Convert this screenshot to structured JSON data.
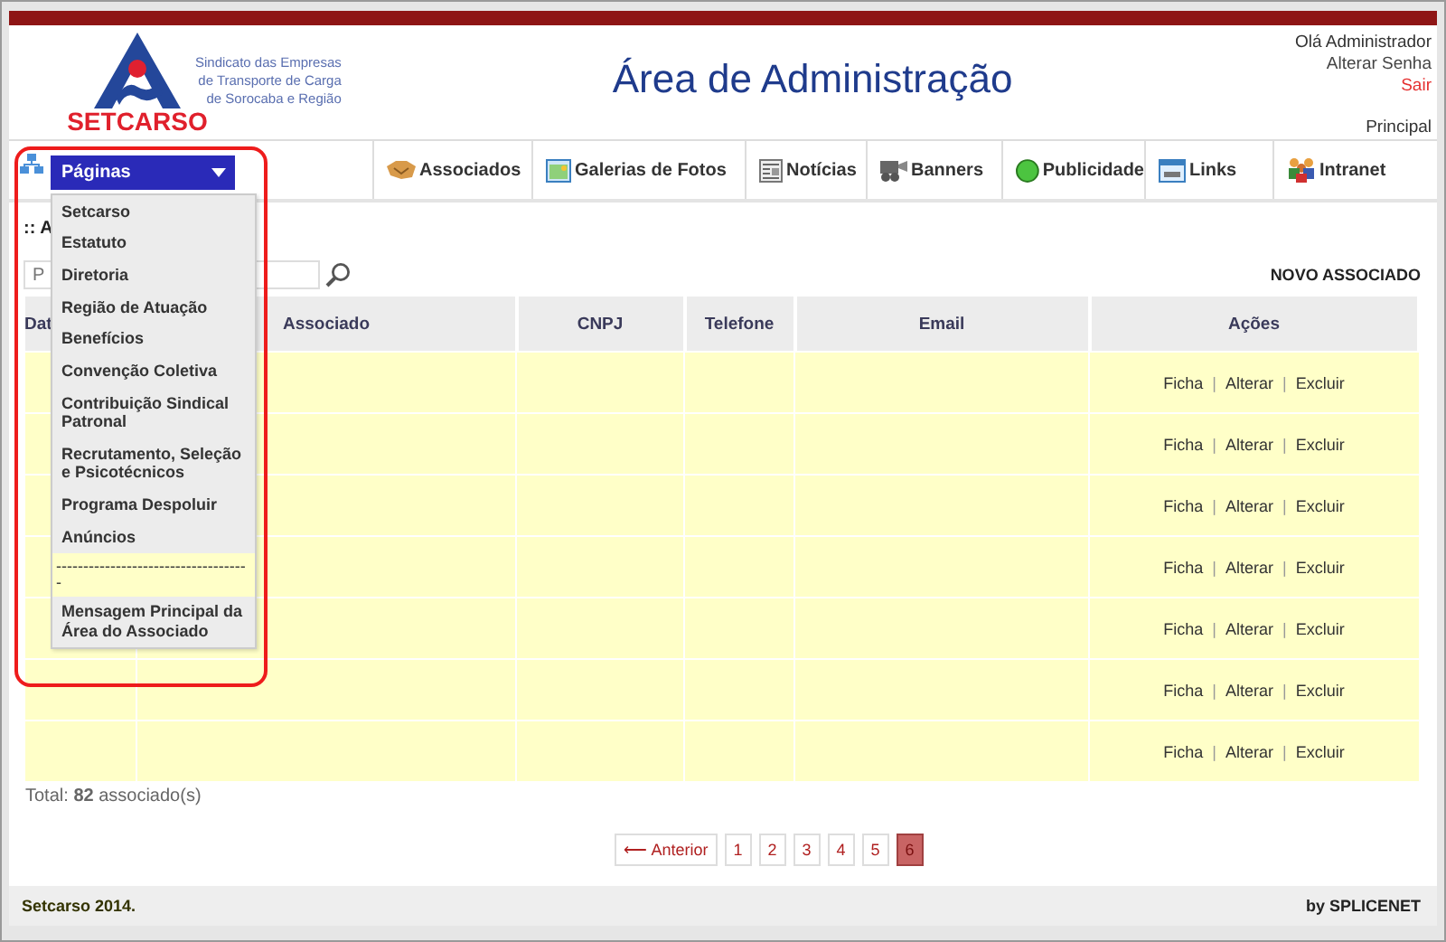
{
  "header": {
    "logo": {
      "name": "SETCARSO",
      "tagline": [
        "Sindicato das Empresas",
        "de Transporte de Carga",
        "de Sorocaba e Região"
      ]
    },
    "title": "Área de Administração",
    "user": {
      "greeting": "Olá Administrador",
      "change_password": "Alterar Senha",
      "logout": "Sair"
    },
    "breadcrumb": "Principal"
  },
  "nav": {
    "pages_menu": {
      "label": "Páginas",
      "expanded": true,
      "items": [
        {
          "kind": "link",
          "label": "Setcarso"
        },
        {
          "kind": "link",
          "label": "Estatuto"
        },
        {
          "kind": "link",
          "label": "Diretoria"
        },
        {
          "kind": "link",
          "label": "Região de Atuação"
        },
        {
          "kind": "link",
          "label": "Benefícios"
        },
        {
          "kind": "link",
          "label": "Convenção Coletiva"
        },
        {
          "kind": "link",
          "label": "Contribuição Sindical Patronal"
        },
        {
          "kind": "link",
          "label": "Recrutamento, Seleção e Psicotécnicos"
        },
        {
          "kind": "link",
          "label": "Programa Despoluir"
        },
        {
          "kind": "link",
          "label": "Anúncios"
        },
        {
          "kind": "separator",
          "label": "-----------------------------------  -"
        },
        {
          "kind": "link",
          "label": "Mensagem Principal da Área do Associado"
        }
      ]
    },
    "items": [
      {
        "kind": "handshake",
        "label": "Associados"
      },
      {
        "kind": "gallery",
        "label": "Galerias de Fotos"
      },
      {
        "kind": "news",
        "label": "Notícias"
      },
      {
        "kind": "banner",
        "label": "Banners"
      },
      {
        "kind": "ad",
        "label": "Publicidade"
      },
      {
        "kind": "links",
        "label": "Links"
      },
      {
        "kind": "people",
        "label": "Intranet"
      }
    ]
  },
  "section_title": ":: A",
  "search": {
    "placeholder": "P"
  },
  "new_button": "NOVO ASSOCIADO",
  "table": {
    "columns": [
      "Dat",
      "Associado",
      "CNPJ",
      "Telefone",
      "Email",
      "Ações"
    ],
    "rows": [
      {
        "actions": [
          {
            "kind": "link",
            "text": "Ficha"
          },
          {
            "kind": "sep",
            "text": "|"
          },
          {
            "kind": "link",
            "text": "Alterar"
          },
          {
            "kind": "sep",
            "text": "|"
          },
          {
            "kind": "link",
            "text": "Excluir"
          }
        ]
      },
      {
        "actions": [
          {
            "kind": "link",
            "text": "Ficha"
          },
          {
            "kind": "sep",
            "text": "|"
          },
          {
            "kind": "link",
            "text": "Alterar"
          },
          {
            "kind": "sep",
            "text": "|"
          },
          {
            "kind": "link",
            "text": "Excluir"
          }
        ]
      },
      {
        "actions": [
          {
            "kind": "link",
            "text": "Ficha"
          },
          {
            "kind": "sep",
            "text": "|"
          },
          {
            "kind": "link",
            "text": "Alterar"
          },
          {
            "kind": "sep",
            "text": "|"
          },
          {
            "kind": "link",
            "text": "Excluir"
          }
        ]
      },
      {
        "actions": [
          {
            "kind": "link",
            "text": "Ficha"
          },
          {
            "kind": "sep",
            "text": "|"
          },
          {
            "kind": "link",
            "text": "Alterar"
          },
          {
            "kind": "sep",
            "text": "|"
          },
          {
            "kind": "link",
            "text": "Excluir"
          }
        ]
      },
      {
        "actions": [
          {
            "kind": "link",
            "text": "Ficha"
          },
          {
            "kind": "sep",
            "text": "|"
          },
          {
            "kind": "link",
            "text": "Alterar"
          },
          {
            "kind": "sep",
            "text": "|"
          },
          {
            "kind": "link",
            "text": "Excluir"
          }
        ]
      },
      {
        "actions": [
          {
            "kind": "link",
            "text": "Ficha"
          },
          {
            "kind": "sep",
            "text": "|"
          },
          {
            "kind": "link",
            "text": "Alterar"
          },
          {
            "kind": "sep",
            "text": "|"
          },
          {
            "kind": "link",
            "text": "Excluir"
          }
        ]
      },
      {
        "actions": [
          {
            "kind": "link",
            "text": "Ficha"
          },
          {
            "kind": "sep",
            "text": "|"
          },
          {
            "kind": "link",
            "text": "Alterar"
          },
          {
            "kind": "sep",
            "text": "|"
          },
          {
            "kind": "link",
            "text": "Excluir"
          }
        ]
      }
    ]
  },
  "total": "Total: **82** associado(s)",
  "pagination": {
    "previous": "⟵ Anterior",
    "pages": [
      {
        "label": "1",
        "selected": false
      },
      {
        "label": "2",
        "selected": false
      },
      {
        "label": "3",
        "selected": false
      },
      {
        "label": "4",
        "selected": false
      },
      {
        "label": "5",
        "selected": false
      },
      {
        "label": "6",
        "selected": true
      }
    ]
  },
  "footer": {
    "left": "Setcarso 2014.",
    "right": "by SPLICENET"
  }
}
